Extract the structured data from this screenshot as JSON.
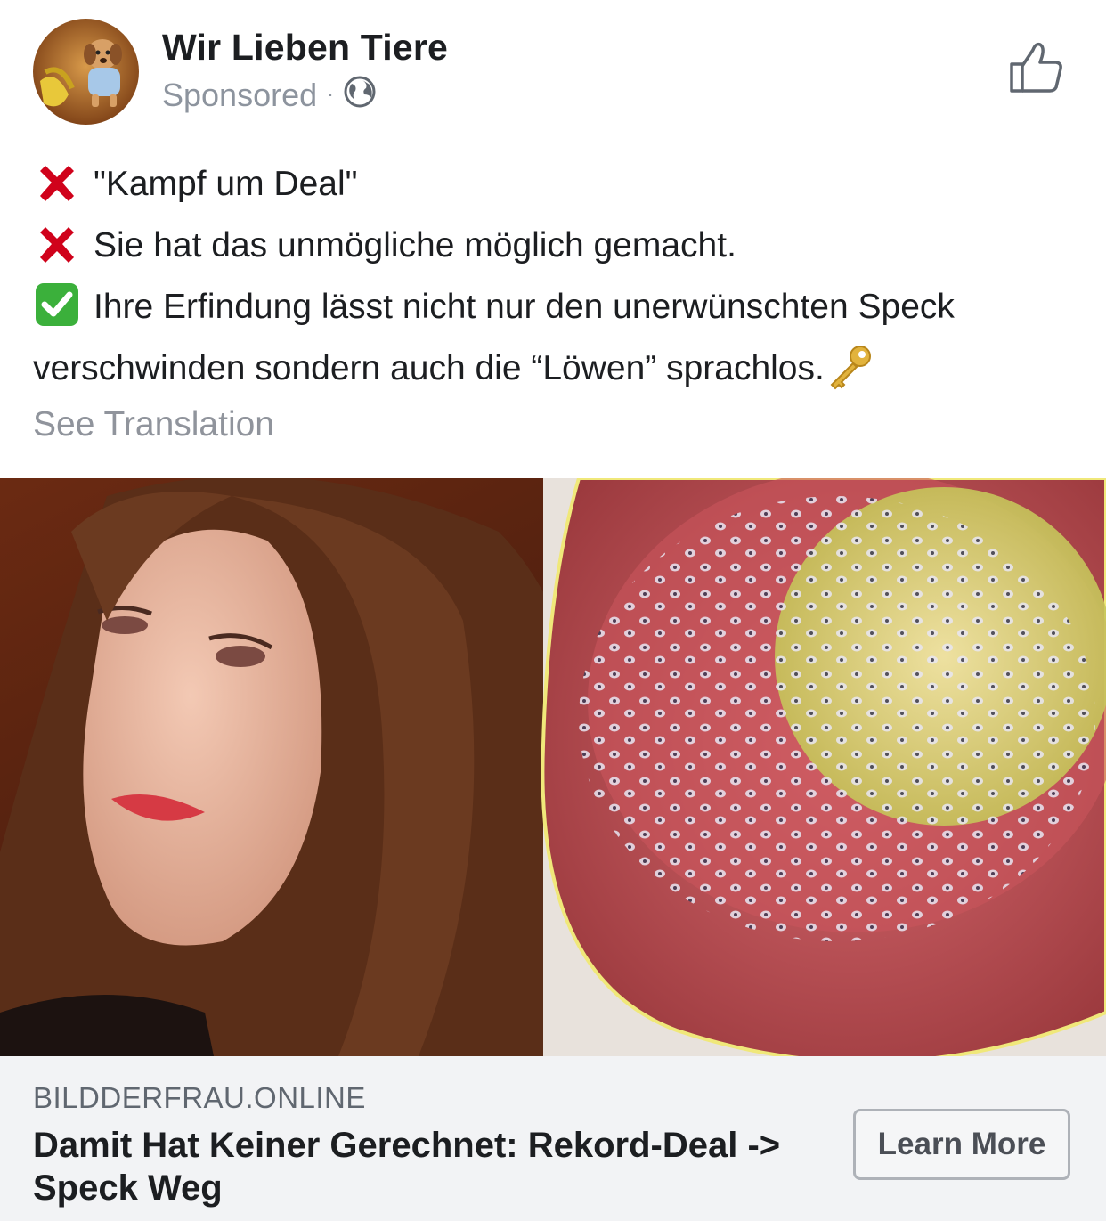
{
  "post": {
    "page_name": "Wir Lieben Tiere",
    "sponsored_label": "Sponsored",
    "separator": "·",
    "audience_icon": "globe-icon",
    "like_icon": "thumbs-up-icon",
    "lines": [
      {
        "icon": "red-x-emoji",
        "text": "\"Kampf um Deal\""
      },
      {
        "icon": "red-x-emoji",
        "text": "Sie hat das unmögliche möglich gemacht."
      },
      {
        "icon": "check-mark-emoji",
        "text": "Ihre Erfindung lässt nicht nur den unerwünschten Speck verschwinden sondern auch die “Löwen” sprachlos."
      }
    ],
    "trailing_icon": "key-emoji",
    "see_translation": "See Translation"
  },
  "link_preview": {
    "domain": "BILDDERFRAU.ONLINE",
    "headline": "Damit Hat Keiner Gerechnet: Rekord-Deal -> Speck Weg",
    "cta_label": "Learn More"
  },
  "colors": {
    "text_primary": "#1c1e21",
    "text_secondary": "#8d949e",
    "link_bar_bg": "#f2f3f5",
    "cross_red": "#d0021b",
    "check_green": "#3bb03b"
  }
}
